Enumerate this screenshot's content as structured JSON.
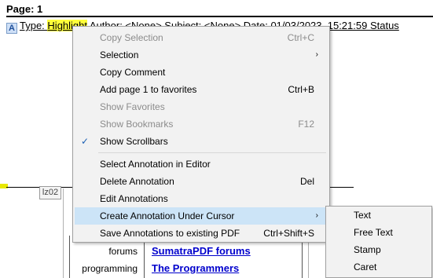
{
  "document": {
    "page_header": "Page: 1",
    "annotation": {
      "prefix": "Type: ",
      "type_value": "Highlight",
      "rest": " Author: <None>  Subject: <None>  Date: 01/03/2023, 15:21:59  Status"
    },
    "tooltip_tab": "lz02",
    "rows": [
      {
        "label": "forums",
        "link": "SumatraPDF forums"
      },
      {
        "label": "programming",
        "link": "The Programmers"
      }
    ]
  },
  "context_menu": {
    "items": [
      {
        "label": "Copy Selection",
        "shortcut": "Ctrl+C",
        "disabled": true
      },
      {
        "label": "Selection",
        "submenu": true
      },
      {
        "label": "Copy Comment"
      },
      {
        "label": "Add page 1 to favorites",
        "shortcut": "Ctrl+B"
      },
      {
        "label": "Show Favorites",
        "disabled": true
      },
      {
        "label": "Show Bookmarks",
        "shortcut": "F12",
        "disabled": true
      },
      {
        "label": "Show Scrollbars",
        "checked": true
      },
      {
        "label": "Select Annotation in Editor"
      },
      {
        "label": "Delete Annotation",
        "shortcut": "Del"
      },
      {
        "label": "Edit Annotations"
      },
      {
        "label": "Create Annotation Under Cursor",
        "submenu": true,
        "active": true
      },
      {
        "label": "Save Annotations to existing PDF",
        "shortcut": "Ctrl+Shift+S"
      }
    ],
    "arrow_glyph": "›",
    "check_glyph": "✓"
  },
  "submenu": {
    "items": [
      {
        "label": "Text"
      },
      {
        "label": "Free Text"
      },
      {
        "label": "Stamp"
      },
      {
        "label": "Caret"
      }
    ]
  },
  "colors": {
    "highlight": "#ffff3a",
    "menu_bg": "#f2f2f2",
    "menu_active": "#cce4f7",
    "disabled_text": "#8c8c8c",
    "link": "#0000cc"
  }
}
